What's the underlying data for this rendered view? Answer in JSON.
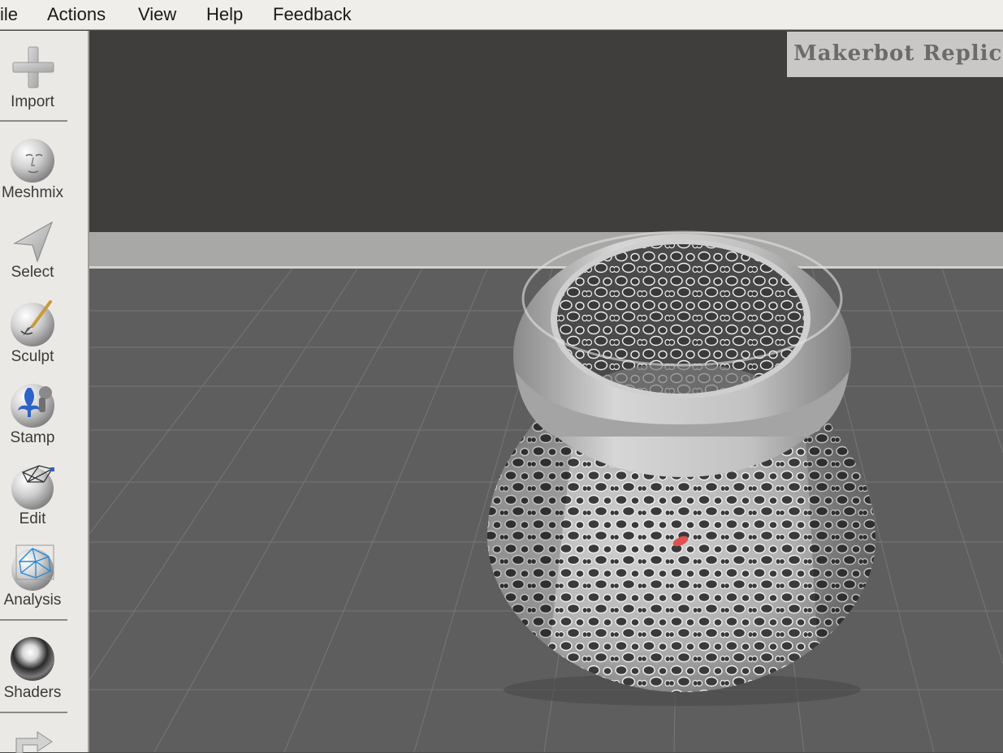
{
  "menu": {
    "items": [
      "ile",
      "Actions",
      "View",
      "Help",
      "Feedback"
    ]
  },
  "toolbar": {
    "tools": [
      {
        "label": "Import",
        "icon": "plus-icon"
      },
      {
        "label": "Meshmix",
        "icon": "face-sphere-icon"
      },
      {
        "label": "Select",
        "icon": "arrow-cursor-icon"
      },
      {
        "label": "Sculpt",
        "icon": "brush-sphere-icon"
      },
      {
        "label": "Stamp",
        "icon": "fleur-de-lis-sphere-icon"
      },
      {
        "label": "Edit",
        "icon": "wireframe-sphere-icon"
      },
      {
        "label": "Analysis",
        "icon": "mesh-analysis-sphere-icon"
      },
      {
        "label": "Shaders",
        "icon": "chrome-sphere-icon"
      }
    ]
  },
  "viewport": {
    "printer_name": "Makerbot Replica",
    "background_color": "#3f3e3c",
    "bed_color": "#5e5e5e",
    "grid_color": "#7a7a7a",
    "model_color": "#b7b7b7",
    "highlight_color": "#e05050"
  }
}
